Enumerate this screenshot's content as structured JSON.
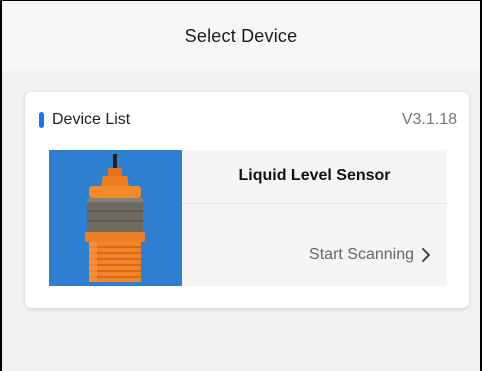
{
  "header": {
    "title": "Select Device"
  },
  "device_list": {
    "title": "Device List",
    "version": "V3.1.18",
    "accent_color": "#1a73e8",
    "items": [
      {
        "name": "Liquid Level Sensor",
        "action_label": "Start Scanning",
        "action_icon": "chevron-right-icon",
        "image_background": "#2f7fd0"
      }
    ]
  }
}
